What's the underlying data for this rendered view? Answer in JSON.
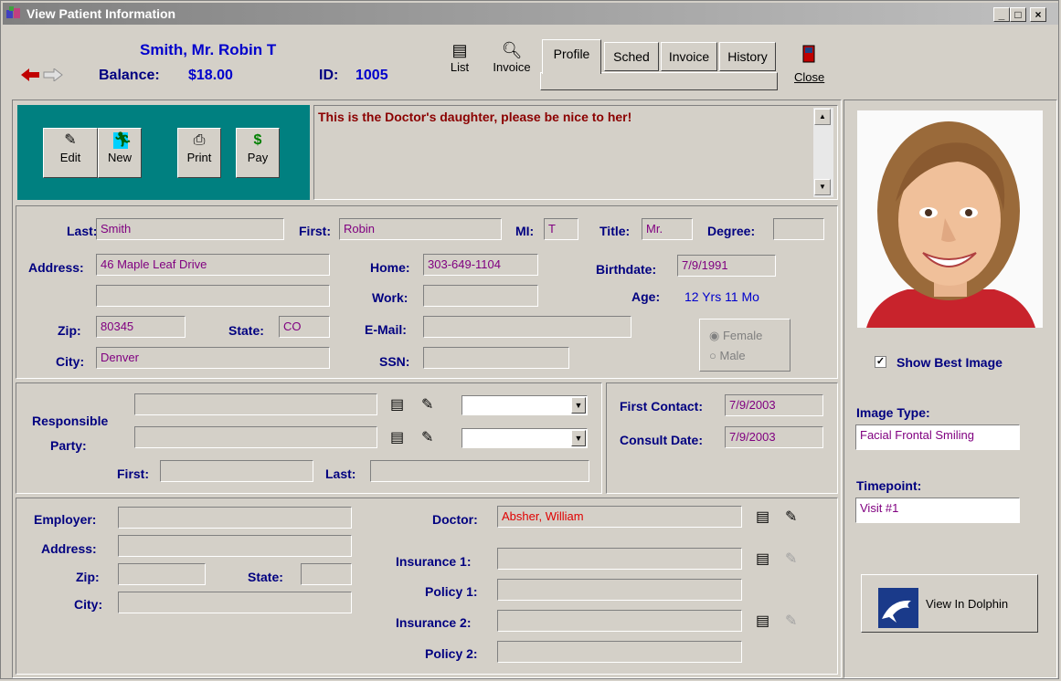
{
  "window": {
    "title": "View Patient Information",
    "min": "_",
    "max": "□",
    "close": "×"
  },
  "header": {
    "patient_name": "Smith, Mr. Robin T",
    "balance_label": "Balance:",
    "balance_value": "$18.00",
    "id_label": "ID:",
    "id_value": "1005",
    "list_label": "List",
    "invoice_label": "Invoice",
    "close_label": "Close"
  },
  "tabs": [
    {
      "label": "Profile",
      "selected": true
    },
    {
      "label": "Sched"
    },
    {
      "label": "Invoice"
    },
    {
      "label": "History"
    }
  ],
  "actions": {
    "edit": "Edit",
    "new": "New",
    "print": "Print",
    "pay": "Pay"
  },
  "note": "This is the Doctor's daughter, please be nice to her!",
  "demographics": {
    "last_label": "Last:",
    "last": "Smith",
    "first_label": "First:",
    "first": "Robin",
    "mi_label": "MI:",
    "mi": "T",
    "title_label": "Title:",
    "title": "Mr.",
    "degree_label": "Degree:",
    "degree": "",
    "address_label": "Address:",
    "address1": "46 Maple Leaf Drive",
    "address2": "",
    "zip_label": "Zip:",
    "zip": "80345",
    "state_label": "State:",
    "state": "CO",
    "city_label": "City:",
    "city": "Denver",
    "home_label": "Home:",
    "home": "303-649-1104",
    "work_label": "Work:",
    "work": "",
    "email_label": "E-Mail:",
    "email": "",
    "ssn_label": "SSN:",
    "ssn": "",
    "birthdate_label": "Birthdate:",
    "birthdate": "7/9/1991",
    "age_label": "Age:",
    "age": "12 Yrs 11 Mo",
    "gender_options": [
      "Female",
      "Male"
    ],
    "gender_selected": "Female"
  },
  "responsible": {
    "label_line1": "Responsible",
    "label_line2": "Party:",
    "first_label": "First:",
    "last_label": "Last:",
    "first_contact_label": "First Contact:",
    "first_contact": "7/9/2003",
    "consult_date_label": "Consult Date:",
    "consult_date": "7/9/2003"
  },
  "employer": {
    "employer_label": "Employer:",
    "address_label": "Address:",
    "zip_label": "Zip:",
    "state_label": "State:",
    "city_label": "City:",
    "doctor_label": "Doctor:",
    "doctor": "Absher, William",
    "insurance1_label": "Insurance 1:",
    "policy1_label": "Policy 1:",
    "insurance2_label": "Insurance 2:",
    "policy2_label": "Policy 2:"
  },
  "image_panel": {
    "show_best_label": "Show Best Image",
    "show_best_checked": true,
    "image_type_label": "Image Type:",
    "image_type": "Facial Frontal Smiling",
    "timepoint_label": "Timepoint:",
    "timepoint": "Visit #1",
    "dolphin_button": "View In Dolphin"
  },
  "colors": {
    "teal": "#008080",
    "navy": "#000080",
    "purple": "#800080",
    "blue": "#0000ff",
    "red": "#ff0000",
    "darkred": "#8b0000"
  }
}
